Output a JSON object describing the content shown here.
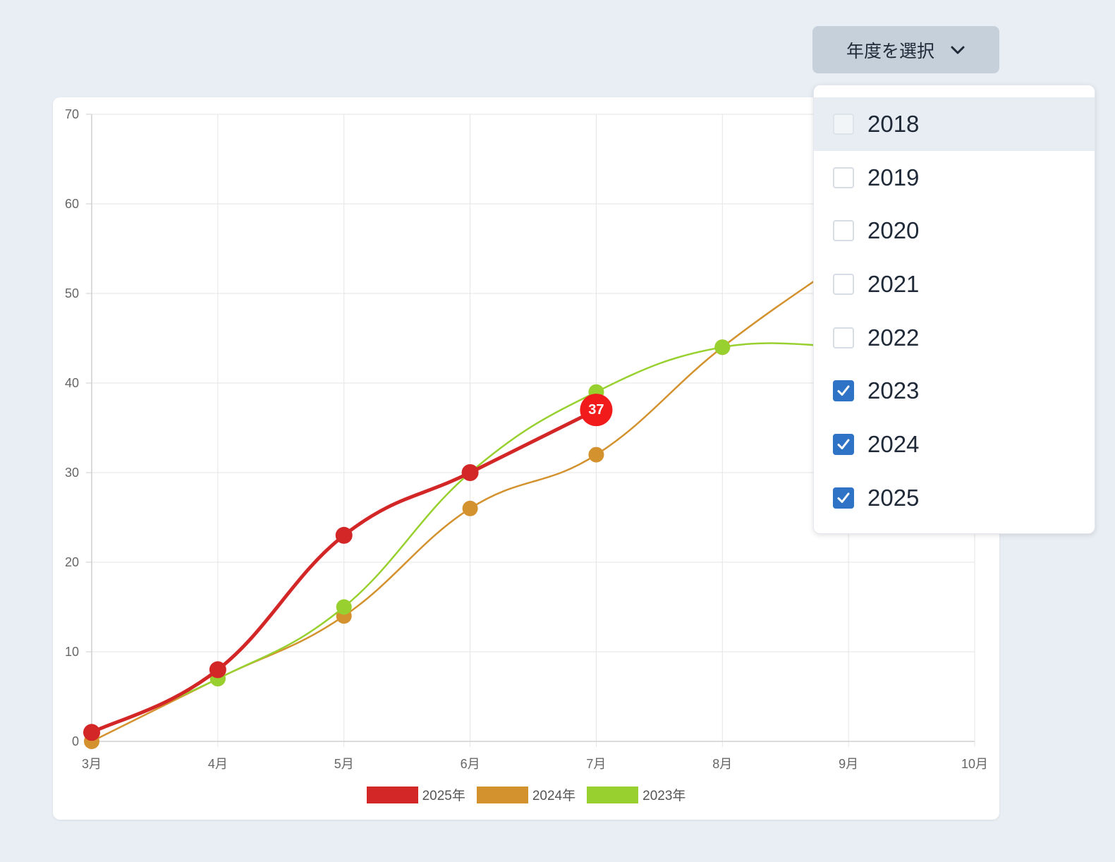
{
  "selector": {
    "button_label": "年度を選択",
    "options": [
      {
        "label": "2018",
        "checked": false,
        "highlighted": true
      },
      {
        "label": "2019",
        "checked": false,
        "highlighted": false
      },
      {
        "label": "2020",
        "checked": false,
        "highlighted": false
      },
      {
        "label": "2021",
        "checked": false,
        "highlighted": false
      },
      {
        "label": "2022",
        "checked": false,
        "highlighted": false
      },
      {
        "label": "2023",
        "checked": true,
        "highlighted": false
      },
      {
        "label": "2024",
        "checked": true,
        "highlighted": false
      },
      {
        "label": "2025",
        "checked": true,
        "highlighted": false
      }
    ]
  },
  "colors": {
    "page_background": "#e9eef5",
    "checkbox_checked": "#2f73c7",
    "button_background": "#c6d0db"
  },
  "chart_data": {
    "type": "line",
    "categories": [
      "3月",
      "4月",
      "5月",
      "6月",
      "7月",
      "8月",
      "9月",
      "10月"
    ],
    "y_ticks": [
      0,
      10,
      20,
      30,
      40,
      50,
      60,
      70
    ],
    "ylim": [
      0,
      70
    ],
    "grid": true,
    "legend_position": "bottom",
    "series": [
      {
        "name": "2025年",
        "color": "#d32626",
        "values": [
          1,
          8,
          23,
          30,
          37,
          null,
          null,
          null
        ]
      },
      {
        "name": "2024年",
        "color": "#d4922e",
        "values": [
          0,
          7,
          14,
          26,
          32,
          44,
          54,
          null
        ]
      },
      {
        "name": "2023年",
        "color": "#98d12f",
        "values": [
          1,
          7,
          15,
          30,
          39,
          44,
          44,
          null
        ]
      }
    ],
    "highlighted_point": {
      "series": "2025年",
      "category": "7月",
      "label": "37"
    }
  }
}
